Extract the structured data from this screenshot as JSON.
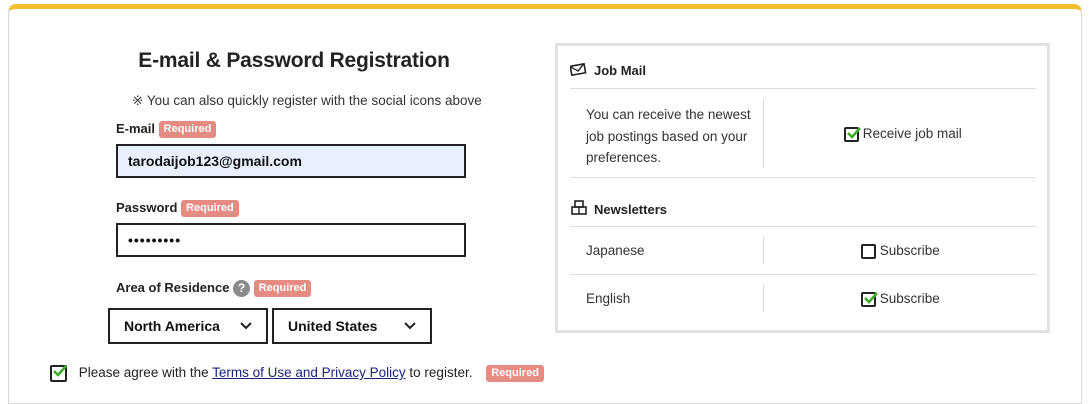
{
  "form": {
    "title": "E-mail & Password Registration",
    "note": "※ You can also quickly register with the social icons above",
    "required_label": "Required",
    "email_label": "E-mail",
    "email_value": "tarodaijob123@gmail.com",
    "password_label": "Password",
    "password_value": "•••••••••",
    "area_label": "Area of Residence",
    "help_glyph": "?",
    "region_value": "North America",
    "country_value": "United States",
    "agree_prefix": "Please agree with the ",
    "agree_link": "Terms of Use and Privacy Policy",
    "agree_suffix": " to register.",
    "agree_checked": true
  },
  "panel": {
    "job_mail_title": "Job Mail",
    "job_mail_desc_1": "You can receive the newest",
    "job_mail_desc_2": "job postings based on your",
    "job_mail_desc_3": "preferences.",
    "job_mail_check_label": "Receive job mail",
    "job_mail_checked": true,
    "newsletters_title": "Newsletters",
    "rows": [
      {
        "lang": "Japanese",
        "label": "Subscribe",
        "checked": false
      },
      {
        "lang": "English",
        "label": "Subscribe",
        "checked": true
      }
    ]
  },
  "colors": {
    "accent_top": "#f2bd2a",
    "required_badge": "#e58b82",
    "check_green": "#3fae29"
  }
}
